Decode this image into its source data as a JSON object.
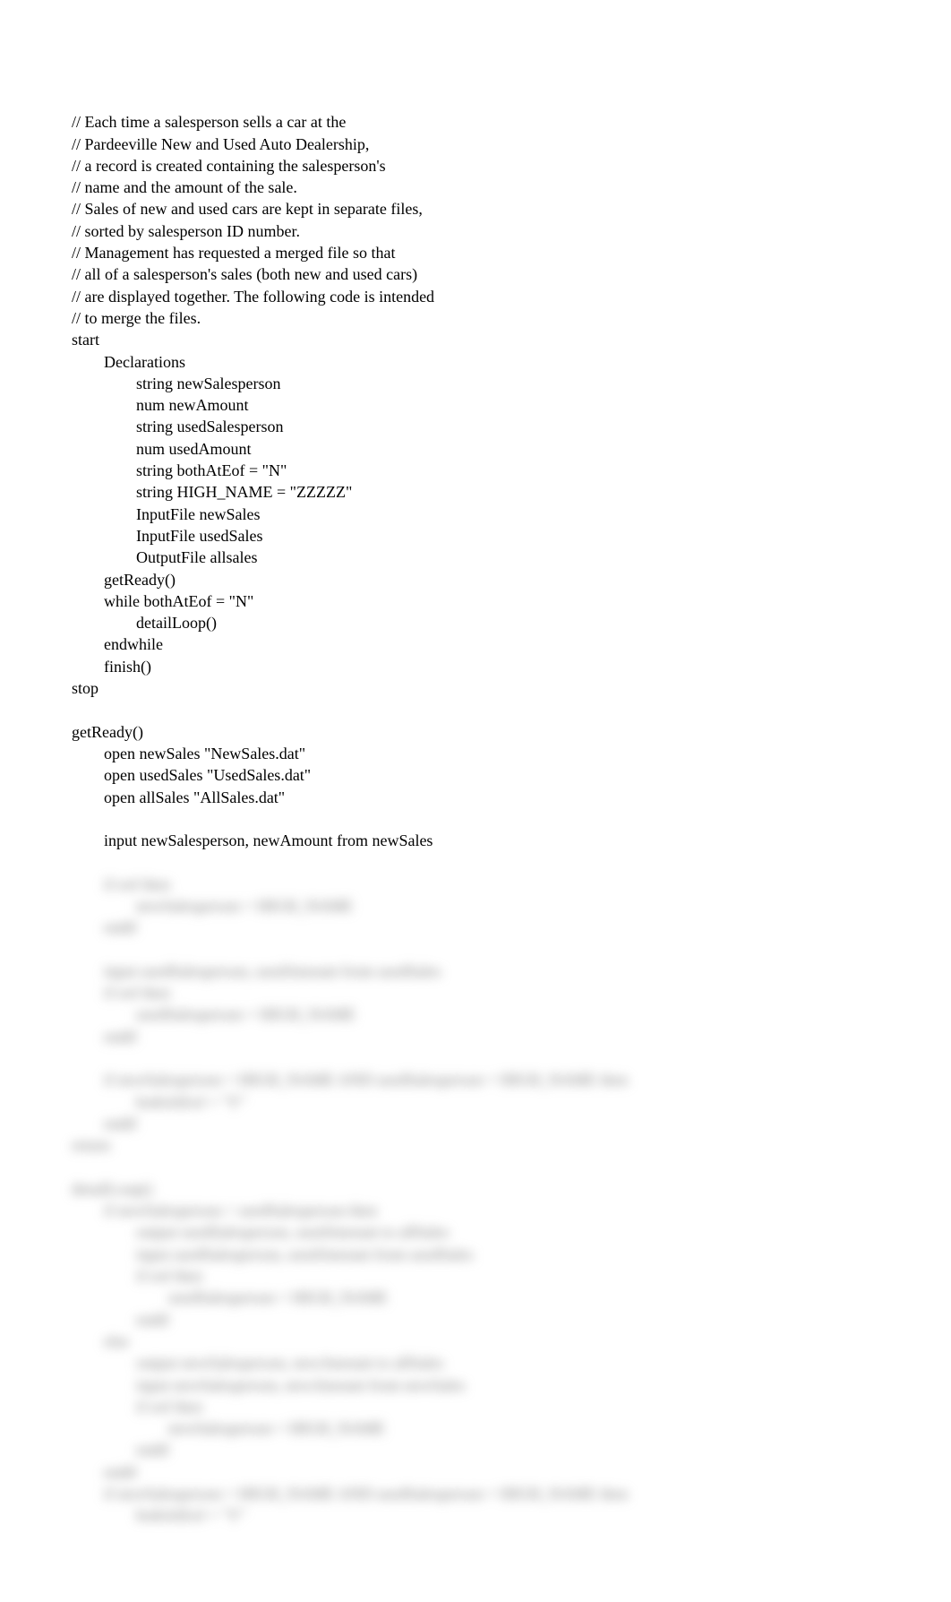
{
  "clear_lines": [
    "// Each time a salesperson sells a car at the",
    "// Pardeeville New and Used Auto Dealership,",
    "// a record is created containing the salesperson's",
    "// name and the amount of the sale.",
    "// Sales of new and used cars are kept in separate files,",
    "// sorted by salesperson ID number.",
    "// Management has requested a merged file so that",
    "// all of a salesperson's sales (both new and used cars)",
    "// are displayed together. The following code is intended",
    "// to merge the files.",
    "start",
    "        Declarations",
    "                string newSalesperson",
    "                num newAmount",
    "                string usedSalesperson",
    "                num usedAmount",
    "                string bothAtEof = \"N\"",
    "                string HIGH_NAME = \"ZZZZZ\"",
    "                InputFile newSales",
    "                InputFile usedSales",
    "                OutputFile allsales",
    "        getReady()",
    "        while bothAtEof = \"N\"",
    "                detailLoop()",
    "        endwhile",
    "        finish()",
    "stop",
    "",
    "getReady()",
    "        open newSales \"NewSales.dat\"",
    "        open usedSales \"UsedSales.dat\"",
    "        open allSales \"AllSales.dat\"",
    "",
    "        input newSalesperson, newAmount from newSales"
  ],
  "blurred_lines": [
    "        if eof then",
    "                newSalesperson = HIGH_NAME",
    "        endif",
    "",
    "        input usedSalesperson, usedAmount from usedSales",
    "        if eof then",
    "                usedSalesperson = HIGH_NAME",
    "        endif",
    "",
    "        if newSalesperson = HIGH_NAME AND usedSalesperson = HIGH_NAME then",
    "                bothAtEof = \"Y\"",
    "        endif",
    "return",
    "",
    "detailLoop()",
    "        if newSalesperson > usedSalesperson then",
    "                output usedSalesperson, usedAmount to allSales",
    "                input usedSalesperson, usedAmount from usedSales",
    "                if eof then",
    "                        usedSalesperson = HIGH_NAME",
    "                endif",
    "        else",
    "                output newSalesperson, newAmount to allSales",
    "                input newSalesperson, newAmount from newSales",
    "                if eof then",
    "                        newSalesperson = HIGH_NAME",
    "                endif",
    "        endif",
    "        if newSalesperson = HIGH_NAME AND usedSalesperson = HIGH_NAME then",
    "                bothAtEof = \"Y\""
  ]
}
